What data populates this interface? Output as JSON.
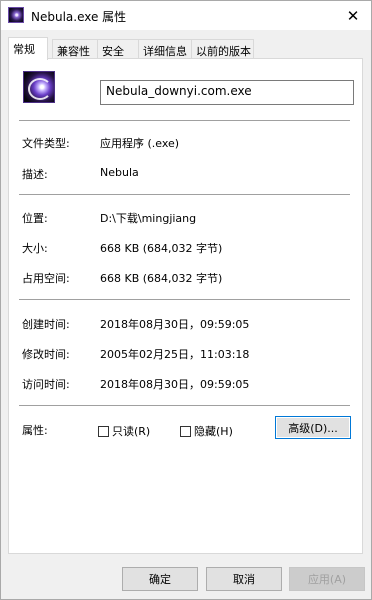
{
  "window": {
    "title": "Nebula.exe 属性"
  },
  "tabs": [
    {
      "label": "常规"
    },
    {
      "label": "兼容性"
    },
    {
      "label": "安全"
    },
    {
      "label": "详细信息"
    },
    {
      "label": "以前的版本"
    }
  ],
  "general": {
    "file_name": "Nebula_downyi.com.exe",
    "rows": [
      {
        "label": "文件类型:",
        "value": "应用程序 (.exe)"
      },
      {
        "label": "描述:",
        "value": "Nebula"
      },
      {
        "label": "位置:",
        "value": "D:\\下载\\mingjiang"
      },
      {
        "label": "大小:",
        "value": "668 KB (684,032 字节)"
      },
      {
        "label": "占用空间:",
        "value": "668 KB (684,032 字节)"
      },
      {
        "label": "创建时间:",
        "value": "2018年08月30日，09:59:05"
      },
      {
        "label": "修改时间:",
        "value": "2005年02月25日，11:03:18"
      },
      {
        "label": "访问时间:",
        "value": "2018年08月30日，09:59:05"
      }
    ],
    "attributes_label": "属性:",
    "readonly_label": "只读(R)",
    "readonly_checked": false,
    "hidden_label": "隐藏(H)",
    "hidden_checked": false,
    "advanced_label": "高级(D)..."
  },
  "footer": {
    "ok": "确定",
    "cancel": "取消",
    "apply": "应用(A)"
  }
}
